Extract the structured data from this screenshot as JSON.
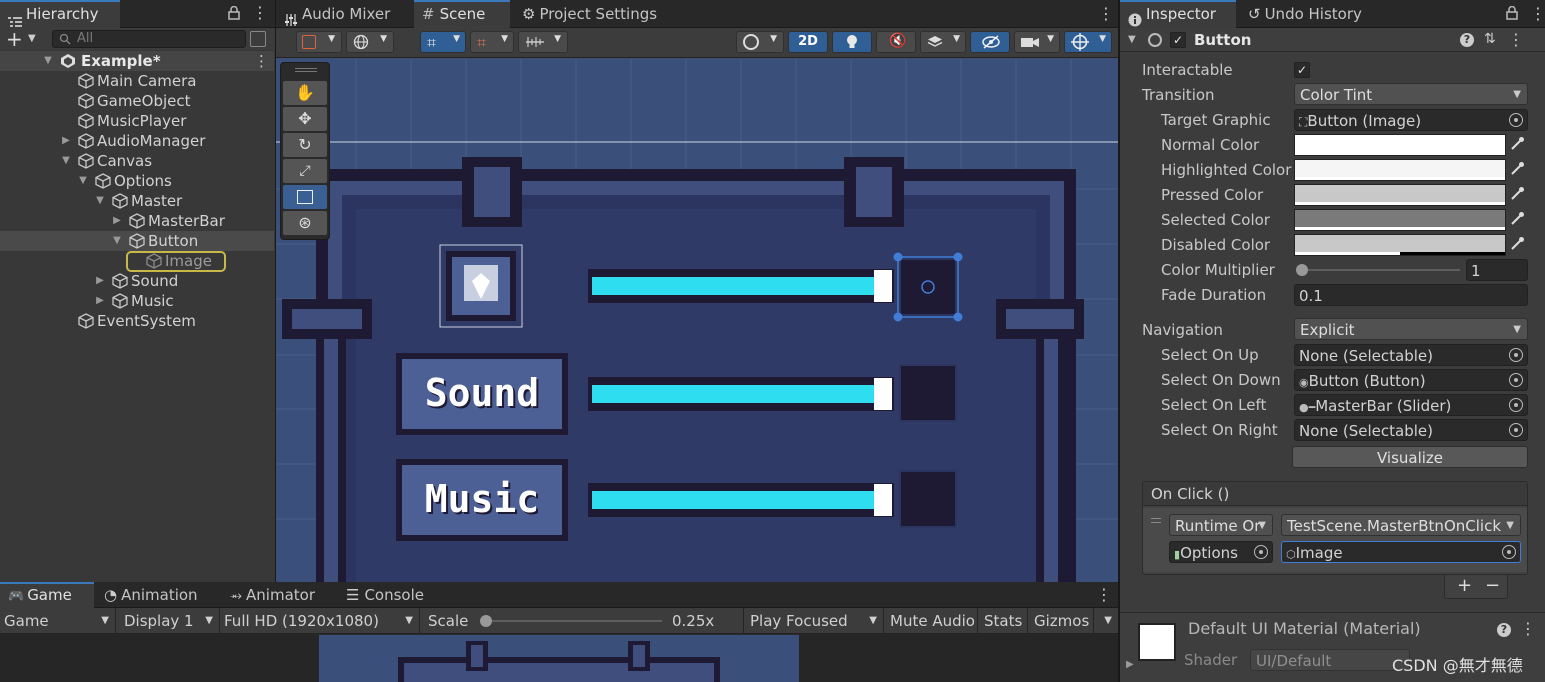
{
  "hierarchy": {
    "tab_label": "Hierarchy",
    "search_placeholder": "All",
    "scene_name": "Example*",
    "items": [
      {
        "label": "Main Camera"
      },
      {
        "label": "GameObject"
      },
      {
        "label": "MusicPlayer"
      },
      {
        "label": "AudioManager"
      },
      {
        "label": "Canvas"
      },
      {
        "label": "Options"
      },
      {
        "label": "Master"
      },
      {
        "label": "MasterBar"
      },
      {
        "label": "Button"
      },
      {
        "label": "Image"
      },
      {
        "label": "Sound"
      },
      {
        "label": "Music"
      },
      {
        "label": "EventSystem"
      }
    ]
  },
  "center_tabs": {
    "audio_mixer": "Audio Mixer",
    "scene": "Scene",
    "project_settings": "Project Settings"
  },
  "scene_toolbar": {
    "mode_2d": "2D"
  },
  "scene_content": {
    "sound_label": "Sound",
    "music_label": "Music"
  },
  "inspector": {
    "tab_label": "Inspector",
    "undo_tab_label": "Undo History",
    "component_name": "Button",
    "properties": {
      "interactable_label": "Interactable",
      "transition_label": "Transition",
      "transition_value": "Color Tint",
      "target_graphic_label": "Target Graphic",
      "target_graphic_value": "Button (Image)",
      "normal_color_label": "Normal Color",
      "highlighted_color_label": "Highlighted Color",
      "pressed_color_label": "Pressed Color",
      "selected_color_label": "Selected Color",
      "disabled_color_label": "Disabled Color",
      "color_multiplier_label": "Color Multiplier",
      "color_multiplier_value": "1",
      "fade_duration_label": "Fade Duration",
      "fade_duration_value": "0.1",
      "navigation_label": "Navigation",
      "navigation_value": "Explicit",
      "select_on_up_label": "Select On Up",
      "select_on_up_value": "None (Selectable)",
      "select_on_down_label": "Select On Down",
      "select_on_down_value": "Button (Button)",
      "select_on_left_label": "Select On Left",
      "select_on_left_value": "MasterBar (Slider)",
      "select_on_right_label": "Select On Right",
      "select_on_right_value": "None (Selectable)",
      "visualize_label": "Visualize"
    },
    "colors": {
      "normal": "#ffffff",
      "highlighted": "#f5f5f5",
      "pressed": "#c8c8c8",
      "selected": "#7a7a7a",
      "disabled": "#c8c8c8"
    },
    "on_click": {
      "header": "On Click ()",
      "runtime_value": "Runtime Or",
      "function_value": "TestScene.MasterBtnOnClick",
      "object_value": "Options",
      "arg_value": "Image",
      "add_label": "+",
      "remove_label": "−"
    },
    "material": {
      "name": "Default UI Material (Material)",
      "shader_label": "Shader",
      "shader_value": "UI/Default"
    }
  },
  "bottom_tabs": {
    "game": "Game",
    "animation": "Animation",
    "animator": "Animator",
    "console": "Console"
  },
  "game_toolbar": {
    "game_dropdown": "Game",
    "display": "Display 1",
    "resolution": "Full HD (1920x1080)",
    "scale_label": "Scale",
    "scale_value": "0.25x",
    "play_focused": "Play Focused",
    "mute_audio": "Mute Audio",
    "stats": "Stats",
    "gizmos": "Gizmos"
  },
  "watermark": "CSDN @無才無德"
}
